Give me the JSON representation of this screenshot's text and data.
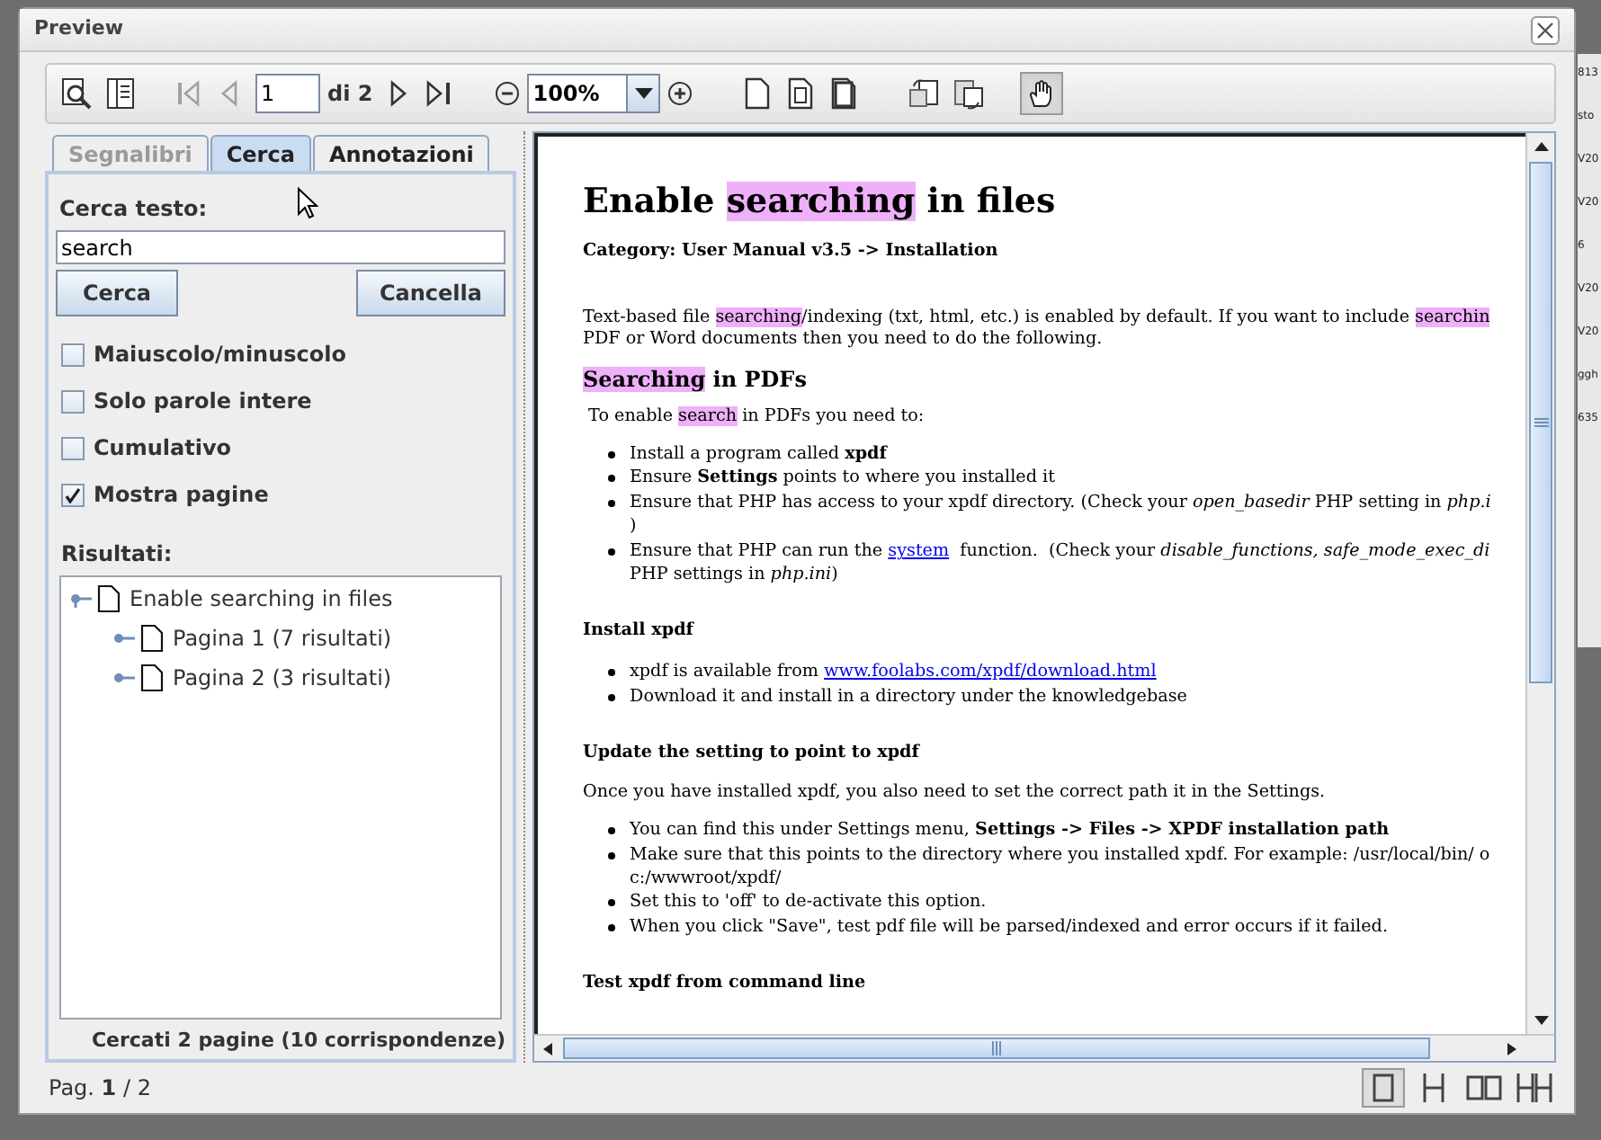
{
  "window": {
    "title": "Preview"
  },
  "toolbar": {
    "nav_buttons": [
      {
        "kind": "first",
        "disabled": true
      },
      {
        "kind": "prev",
        "disabled": true
      },
      {
        "kind": "next",
        "disabled": false
      },
      {
        "kind": "last",
        "disabled": false
      }
    ],
    "page_field": {
      "value": "1"
    },
    "page_count": "di 2",
    "zoom_field": {
      "value": "100%"
    },
    "pan_tool": {
      "selected": true
    }
  },
  "side_panel": {
    "tabs": [
      {
        "label": "Segnalibri",
        "selected": false,
        "disabled": true
      },
      {
        "label": "Cerca",
        "selected": true,
        "disabled": false
      },
      {
        "label": "Annotazioni",
        "selected": false,
        "disabled": false
      }
    ],
    "search_label": "Cerca testo:",
    "search_field": {
      "value": "search"
    },
    "buttons": [
      "Cerca",
      "Cancella"
    ],
    "options": [
      {
        "label": "Maiuscolo/minuscolo",
        "checked": false
      },
      {
        "label": "Solo parole intere",
        "checked": false
      },
      {
        "label": "Cumulativo",
        "checked": false
      },
      {
        "label": "Mostra pagine",
        "checked": true
      }
    ],
    "results_label": "Risultati:",
    "results": [
      {
        "label": "Enable searching in files",
        "expanded": true,
        "children": [
          {
            "label": "Pagina 1 (7 risultati)",
            "expanded": false
          },
          {
            "label": "Pagina 2 (3 risultati)",
            "expanded": false
          }
        ]
      }
    ],
    "summary": "Cercati 2 pagine (10 corrispondenze)"
  },
  "document": {
    "blocks": [
      {
        "kind": "h1",
        "lines": [
          [
            {
              "text": "Enable ",
              "kind": "plain"
            },
            {
              "text": "searching",
              "kind": "highlight"
            },
            {
              "text": " in files",
              "kind": "plain"
            }
          ]
        ]
      },
      {
        "kind": "category",
        "lines": [
          [
            {
              "text": "Category: User Manual v3.5 -> Installation",
              "kind": "plain"
            }
          ]
        ]
      },
      {
        "kind": "para",
        "lines": [
          [
            {
              "text": "Text-based file ",
              "kind": "plain"
            },
            {
              "text": "searching",
              "kind": "highlight"
            },
            {
              "text": "/indexing (txt, html, etc.) is enabled by default. If you want to include ",
              "kind": "plain"
            },
            {
              "text": "searchin",
              "kind": "highlight"
            }
          ],
          [
            {
              "text": "PDF or Word documents then you need to do the following.",
              "kind": "plain"
            }
          ]
        ]
      },
      {
        "kind": "h2",
        "lines": [
          [
            {
              "text": "Searching",
              "kind": "highlight"
            },
            {
              "text": " in PDFs",
              "kind": "plain"
            }
          ]
        ]
      },
      {
        "kind": "para",
        "lines": [
          [
            {
              "text": " To enable ",
              "kind": "plain"
            },
            {
              "text": "search",
              "kind": "highlight"
            },
            {
              "text": " in PDFs you need to:",
              "kind": "plain"
            }
          ]
        ]
      },
      {
        "kind": "list",
        "items": [
          {
            "lines": [
              [
                {
                  "text": "Install a program called ",
                  "kind": "plain"
                },
                {
                  "text": "xpdf",
                  "kind": "bold"
                }
              ]
            ]
          },
          {
            "lines": [
              [
                {
                  "text": "Ensure ",
                  "kind": "plain"
                },
                {
                  "text": "Settings",
                  "kind": "bold"
                },
                {
                  "text": " points to where you installed it",
                  "kind": "plain"
                }
              ]
            ]
          },
          {
            "lines": [
              [
                {
                  "text": "Ensure that PHP has access to your xpdf directory. (Check your ",
                  "kind": "plain"
                },
                {
                  "text": "open_basedir",
                  "kind": "italic"
                },
                {
                  "text": " PHP setting in ",
                  "kind": "plain"
                },
                {
                  "text": "php.i",
                  "kind": "italic"
                }
              ],
              [
                {
                  "text": ")",
                  "kind": "plain"
                }
              ]
            ]
          },
          {
            "lines": [
              [
                {
                  "text": "Ensure that PHP can run the ",
                  "kind": "plain"
                },
                {
                  "text": "system",
                  "kind": "link"
                },
                {
                  "text": "  function.  (Check your ",
                  "kind": "plain"
                },
                {
                  "text": "disable_functions, safe_mode_exec_di",
                  "kind": "italic"
                }
              ],
              [
                {
                  "text": "PHP settings in ",
                  "kind": "plain"
                },
                {
                  "text": "php.ini",
                  "kind": "italic"
                },
                {
                  "text": ")",
                  "kind": "plain"
                }
              ]
            ]
          }
        ]
      },
      {
        "kind": "h3",
        "lines": [
          [
            {
              "text": "Install xpdf",
              "kind": "plain"
            }
          ]
        ]
      },
      {
        "kind": "list",
        "items": [
          {
            "lines": [
              [
                {
                  "text": "xpdf is available from ",
                  "kind": "plain"
                },
                {
                  "text": "www.foolabs.com/xpdf/download.html",
                  "kind": "link"
                }
              ]
            ]
          },
          {
            "lines": [
              [
                {
                  "text": "Download it and install in a directory under the knowledgebase",
                  "kind": "plain"
                }
              ]
            ]
          }
        ]
      },
      {
        "kind": "h3",
        "lines": [
          [
            {
              "text": "Update the setting to point to xpdf",
              "kind": "plain"
            }
          ]
        ]
      },
      {
        "kind": "para",
        "lines": [
          [
            {
              "text": "Once you have installed xpdf, you also need to set the correct path it in the Settings.",
              "kind": "plain"
            }
          ]
        ]
      },
      {
        "kind": "list",
        "items": [
          {
            "lines": [
              [
                {
                  "text": "You can find this under Settings menu, ",
                  "kind": "plain"
                },
                {
                  "text": "Settings -> Files -> XPDF installation path",
                  "kind": "bold"
                }
              ]
            ]
          },
          {
            "lines": [
              [
                {
                  "text": "Make sure that this points to the directory where you installed xpdf. For example: /usr/local/bin/ o",
                  "kind": "plain"
                }
              ],
              [
                {
                  "text": "c:/wwwroot/xpdf/",
                  "kind": "plain"
                }
              ]
            ]
          },
          {
            "lines": [
              [
                {
                  "text": "Set this to 'off' to de-activate this option.",
                  "kind": "plain"
                }
              ]
            ]
          },
          {
            "lines": [
              [
                {
                  "text": "When you click \"Save\", test pdf file will be parsed/indexed and error occurs if it failed.",
                  "kind": "plain"
                }
              ]
            ]
          }
        ]
      },
      {
        "kind": "h3",
        "lines": [
          [
            {
              "text": "Test xpdf from command line",
              "kind": "plain"
            }
          ]
        ]
      }
    ]
  },
  "status_bar": {
    "page_label": "Pag. **1** / 2",
    "view_modes": [
      {
        "kind": "single",
        "selected": true
      },
      {
        "kind": "continuous",
        "selected": false
      },
      {
        "kind": "facing",
        "selected": false
      },
      {
        "kind": "facing_continuous",
        "selected": false
      }
    ]
  },
  "background_fragments": [
    "813",
    "sto",
    "V20",
    "V20",
    "6",
    "V20",
    "V20",
    "ggh",
    "635"
  ]
}
